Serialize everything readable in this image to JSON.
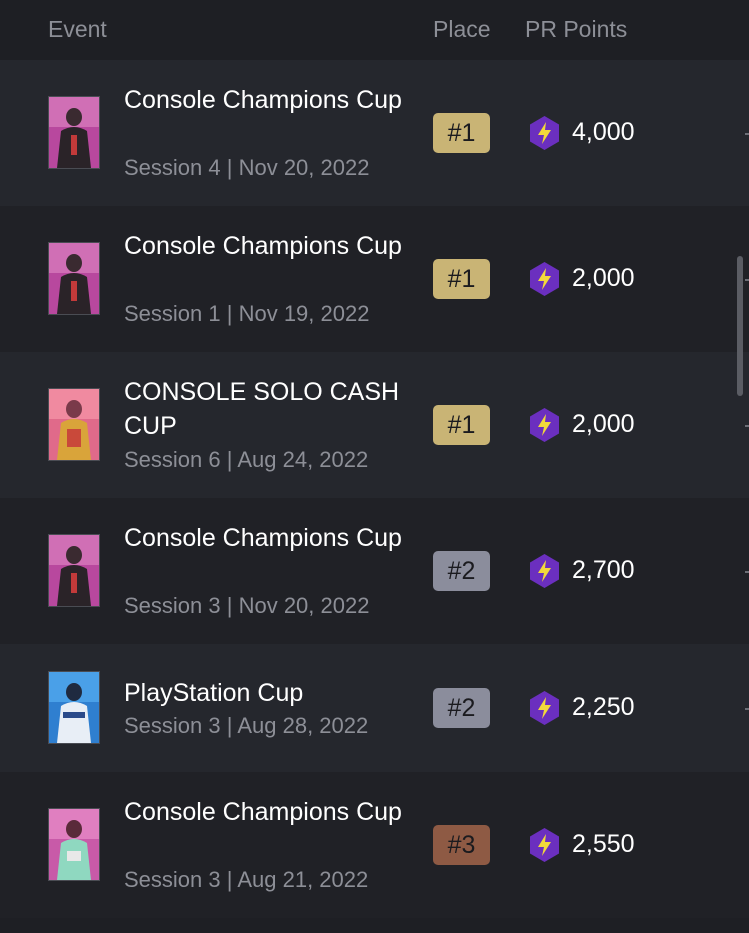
{
  "header": {
    "event": "Event",
    "place": "Place",
    "pr_points": "PR Points",
    "extra": ""
  },
  "colors": {
    "background": "#1e1f24",
    "row_alt": "#25272d",
    "badge_gold": "#c9b475",
    "badge_silver": "#8b8d9c",
    "badge_bronze": "#8e5a44",
    "pr_icon": "#6b2fbf"
  },
  "icons": {
    "pr": "lightning-hexagon-icon",
    "thumb": "outfit-skin-thumbnail"
  },
  "rows": [
    {
      "title": "Console Champions Cup",
      "session": "Session 4",
      "date": "Nov 20, 2022",
      "place": "#1",
      "points": "4,000"
    },
    {
      "title": "Console Champions Cup",
      "session": "Session 1",
      "date": "Nov 19, 2022",
      "place": "#1",
      "points": "2,000"
    },
    {
      "title": "CONSOLE SOLO CASH CUP",
      "session": "Session 6",
      "date": "Aug 24, 2022",
      "place": "#1",
      "points": "2,000"
    },
    {
      "title": "Console Champions Cup",
      "session": "Session 3",
      "date": "Nov 20, 2022",
      "place": "#2",
      "points": "2,700"
    },
    {
      "title": "PlayStation Cup",
      "session": "Session 3",
      "date": "Aug 28, 2022",
      "place": "#2",
      "points": "2,250"
    },
    {
      "title": "Console Champions Cup",
      "session": "Session 3",
      "date": "Aug 21, 2022",
      "place": "#3",
      "points": "2,550"
    }
  ]
}
